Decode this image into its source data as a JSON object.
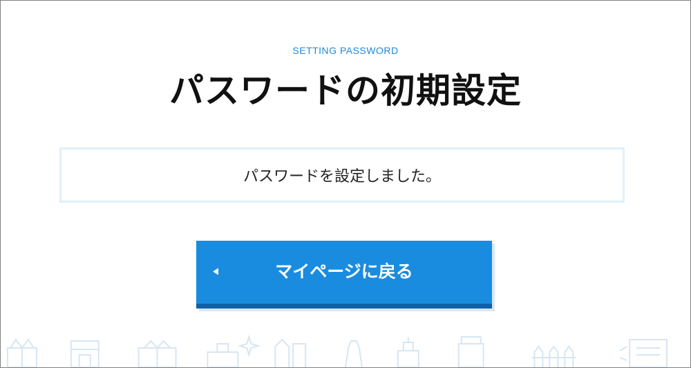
{
  "header": {
    "eyebrow": "SETTING PASSWORD",
    "title": "パスワードの初期設定"
  },
  "message": {
    "text": "パスワードを設定しました。"
  },
  "actions": {
    "back_label": "マイページに戻る"
  },
  "colors": {
    "accent": "#1a8ce0",
    "accent_dark": "#0f5fa8",
    "message_border": "#dff0fb",
    "decor": "#d6e6f2"
  }
}
